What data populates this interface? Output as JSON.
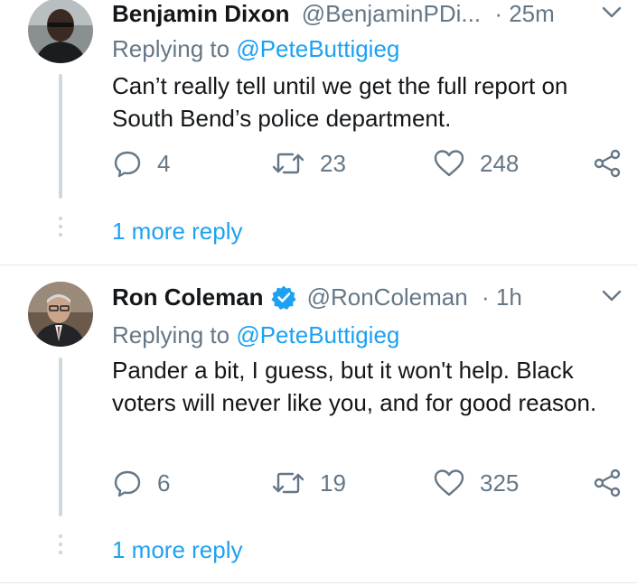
{
  "tweets": [
    {
      "name": "Benjamin Dixon",
      "handle": "@BenjaminPDi...",
      "separator": "·",
      "time": "25m",
      "verified": false,
      "replying_prefix": "Replying to ",
      "replying_to": "@PeteButtigieg",
      "text": "Can’t really tell until we get the full report on South Bend’s police department.",
      "replies": "4",
      "retweets": "23",
      "likes": "248",
      "more_replies": "1 more reply",
      "avatar_icon": "person-avatar"
    },
    {
      "name": "Ron Coleman",
      "handle": "@RonColeman",
      "separator": "·",
      "time": "1h",
      "verified": true,
      "replying_prefix": "Replying to ",
      "replying_to": "@PeteButtigieg",
      "text": "Pander a bit, I guess, but it won't help. Black voters will never like you, and for good reason.",
      "replies": "6",
      "retweets": "19",
      "likes": "325",
      "more_replies": "1 more reply",
      "avatar_icon": "person-avatar"
    }
  ],
  "colors": {
    "accent": "#1da1f2",
    "secondary_text": "#657786",
    "primary_text": "#14171a",
    "divider": "#e1e8ed"
  },
  "icons": [
    "reply-icon",
    "retweet-icon",
    "like-icon",
    "share-icon",
    "chevron-down-icon",
    "verified-badge-icon"
  ]
}
